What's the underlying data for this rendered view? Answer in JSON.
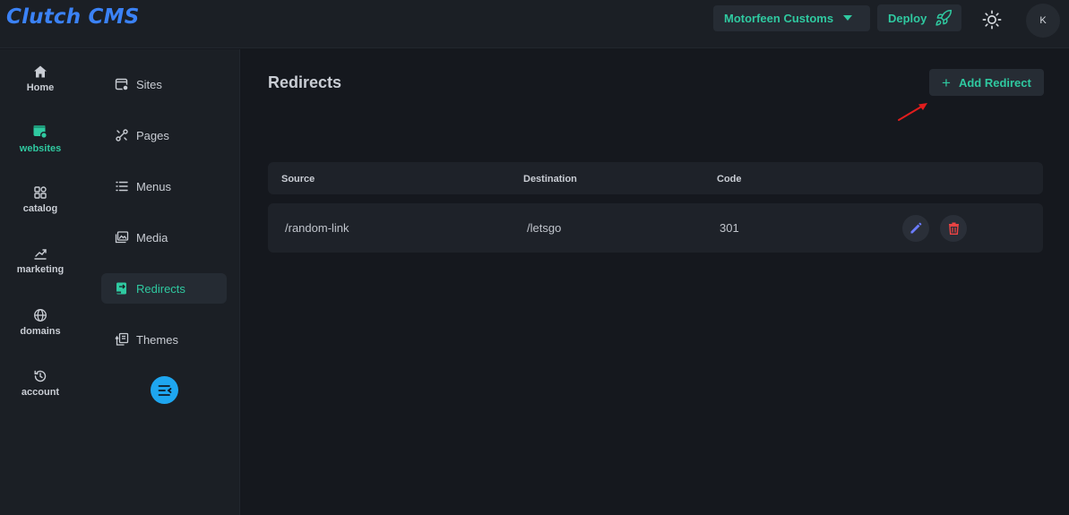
{
  "app": {
    "logo": "Clutch CMS"
  },
  "header": {
    "site_select": "Motorfeen Customs",
    "deploy_label": "Deploy",
    "avatar_initial": "K"
  },
  "rail": [
    {
      "label": "Home",
      "icon": "home-icon",
      "active": false
    },
    {
      "label": "websites",
      "icon": "websites-icon",
      "active": true
    },
    {
      "label": "catalog",
      "icon": "catalog-icon",
      "active": false
    },
    {
      "label": "marketing",
      "icon": "marketing-icon",
      "active": false
    },
    {
      "label": "domains",
      "icon": "globe-icon",
      "active": false
    },
    {
      "label": "account",
      "icon": "history-icon",
      "active": false
    }
  ],
  "subnav": [
    {
      "label": "Sites",
      "icon": "sites-icon",
      "active": false
    },
    {
      "label": "Pages",
      "icon": "pages-icon",
      "active": false
    },
    {
      "label": "Menus",
      "icon": "menus-icon",
      "active": false
    },
    {
      "label": "Media",
      "icon": "media-icon",
      "active": false
    },
    {
      "label": "Redirects",
      "icon": "redirects-icon",
      "active": true
    },
    {
      "label": "Themes",
      "icon": "themes-icon",
      "active": false
    }
  ],
  "main": {
    "title": "Redirects",
    "add_label": "Add Redirect",
    "columns": [
      "Source",
      "Destination",
      "Code"
    ],
    "rows": [
      {
        "source": "/random-link",
        "destination": "/letsgo",
        "code": "301"
      }
    ]
  },
  "colors": {
    "accent": "#2fc9a0",
    "logo": "#3b82f6",
    "collapse": "#1ea6f0",
    "edit": "#6b7cff",
    "delete": "#ef4444",
    "annotation_arrow": "#e11d1d"
  }
}
